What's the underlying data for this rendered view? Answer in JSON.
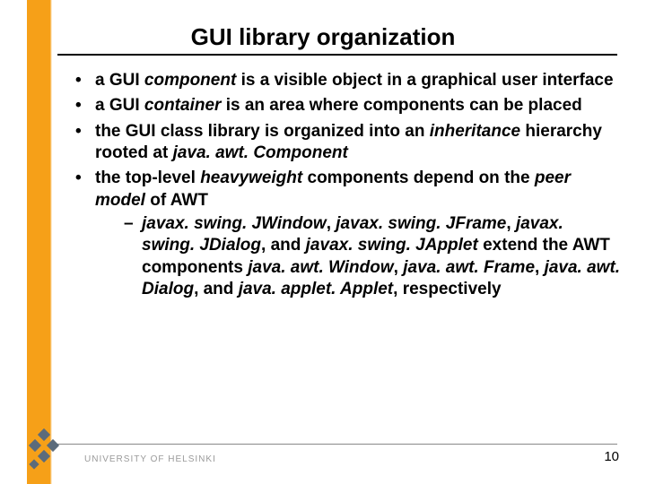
{
  "title": "GUI library organization",
  "bullets": {
    "b1": {
      "pre": "a GUI ",
      "em": "component",
      "post": " is a visible object in a graphical user interface"
    },
    "b2": {
      "pre": "a GUI ",
      "em": "container",
      "post": " is an area where components can be placed"
    },
    "b3": {
      "pre": "the GUI class library is organized into an ",
      "em": "inheritance",
      "post1": " hierarchy rooted at ",
      "em2": "java. awt. Component"
    },
    "b4": {
      "pre": "the top-level ",
      "em": "heavyweight",
      "mid": " components depend on the ",
      "em2": "peer model",
      "post": " of AWT",
      "sub": {
        "s1": "javax. swing. JWindow",
        "s2": ", ",
        "s3": "javax. swing. JFrame",
        "s4": ", ",
        "s5": "javax. swing. JDialog",
        "s6": ", and ",
        "s7": "javax. swing. JApplet",
        "s8": " extend the AWT components ",
        "s9": "java. awt. Window",
        "s10": ", ",
        "s11": "java. awt. Frame",
        "s12": ", ",
        "s13": "java. awt. Dialog",
        "s14": ", and ",
        "s15": "java. applet. Applet",
        "s16": ", respectively"
      }
    }
  },
  "footer": {
    "org": "UNIVERSITY OF HELSINKI"
  },
  "page_number": "10"
}
